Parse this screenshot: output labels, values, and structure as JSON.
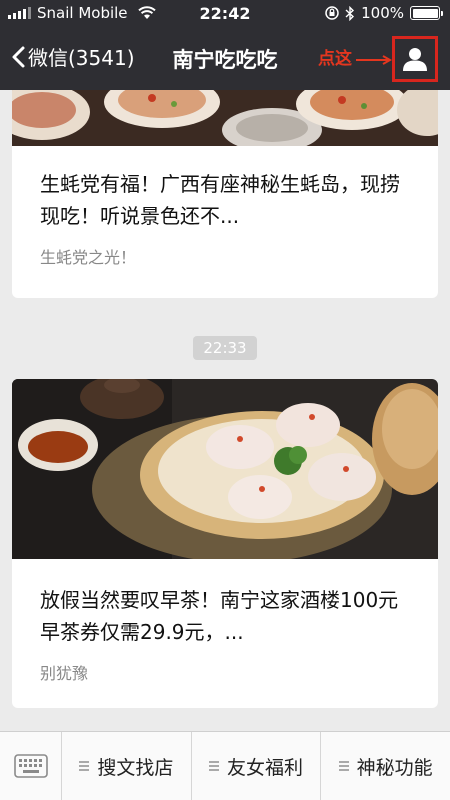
{
  "status_bar": {
    "carrier": "Snail Mobile",
    "time": "22:42",
    "battery_text": "100%",
    "battery_level": 1.0
  },
  "nav": {
    "back_label": "微信(3541)",
    "title": "南宁吃吃吃",
    "hint_text": "点这",
    "icons": [
      "back-chevron-icon",
      "person-icon",
      "arrow-right-icon"
    ]
  },
  "articles": [
    {
      "title": "生蚝党有福！广西有座神秘生蚝岛，现捞现吃！听说景色还不...",
      "source": "生蚝党之光！",
      "image": "grilled-oysters"
    },
    {
      "title": "放假当然要叹早茶！南宁这家酒楼100元早茶券仅需29.9元，...",
      "source": "别犹豫",
      "image": "dim-sum-har-gow"
    }
  ],
  "timestamp_divider": "22:33",
  "bottom_menu": {
    "keyboard_icon": "keyboard-icon",
    "items": [
      {
        "label": "搜文找店"
      },
      {
        "label": "友女福利"
      },
      {
        "label": "神秘功能"
      }
    ]
  },
  "colors": {
    "bar_bg": "#2e2e33",
    "page_bg": "#ebebeb",
    "highlight_red": "#d8261e"
  }
}
